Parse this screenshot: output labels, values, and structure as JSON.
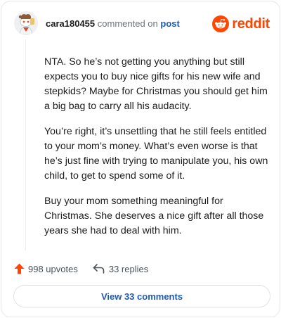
{
  "header": {
    "username": "cara180455",
    "verb": "commented on",
    "post_link": "post",
    "brand_text": "reddit",
    "brand_color": "#ff4500"
  },
  "comment": {
    "paragraphs": [
      "NTA. So he’s not getting you anything but still expects you to buy nice gifts for his new wife and stepkids? Maybe for Christmas you should get him a big bag to carry all his audacity.",
      "You’re right, it’s unsettling that he still feels entitled to your mom’s money. What’s even worse is that he’s just fine with trying to manipulate you, his own child, to get to spend some of it.",
      "Buy your mom something meaningful for Christmas. She deserves a nice gift after all those years she had to deal with him."
    ]
  },
  "actions": {
    "upvotes": "998 upvotes",
    "replies": "33 replies",
    "upvote_icon": "upvote-arrow-icon",
    "reply_icon": "reply-arrow-icon"
  },
  "footer": {
    "view_comments_label": "View 33 comments"
  },
  "colors": {
    "link": "#1c5bb8",
    "upvote": "#ff4500",
    "muted": "#6b7378"
  }
}
